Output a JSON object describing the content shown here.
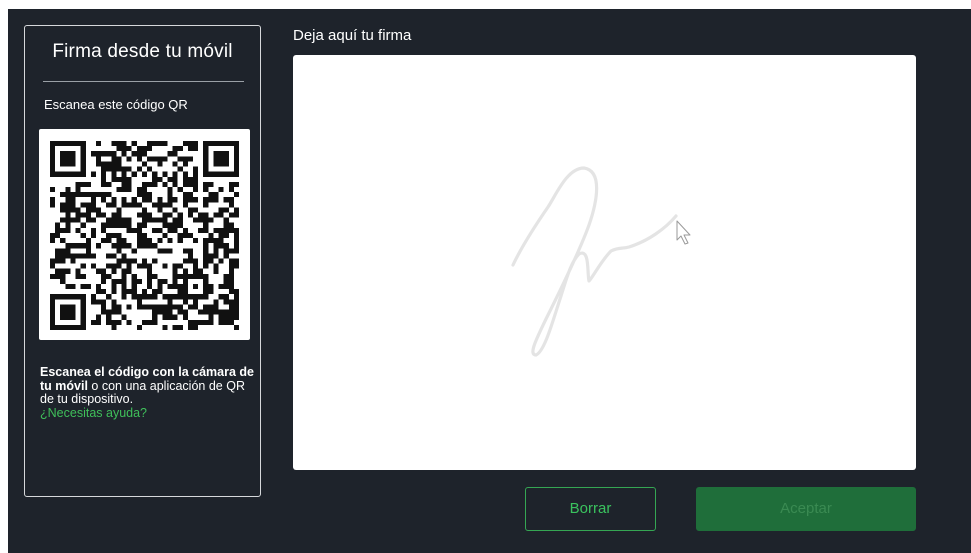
{
  "mobile": {
    "title": "Firma desde tu móvil",
    "scan_label": "Escanea este código QR",
    "instructions_bold": "Escanea el código con la cámara de tu móvil",
    "instructions_rest": " o con una aplicación de QR de tu dispositivo.",
    "help_link": "¿Necesitas ayuda?"
  },
  "signature": {
    "title": "Deja aquí tu firma"
  },
  "actions": {
    "clear_label": "Borrar",
    "accept_label": "Aceptar",
    "accept_enabled": false
  },
  "colors": {
    "background": "#1e232b",
    "accent": "#3ac25e",
    "accept_disabled_bg": "#1f6e3a"
  }
}
